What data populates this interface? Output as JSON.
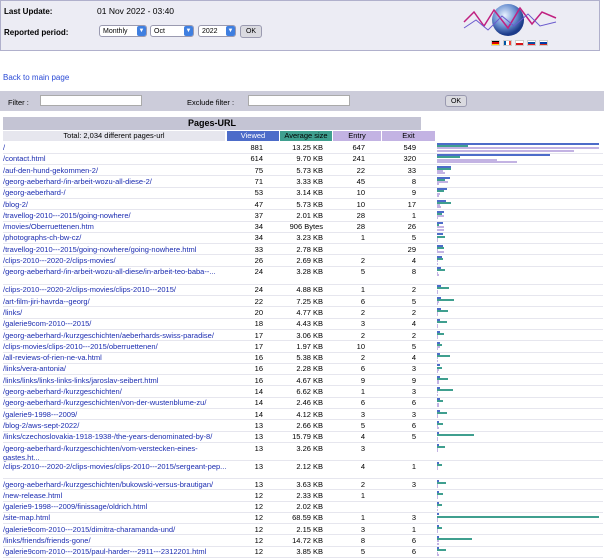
{
  "header": {
    "last_update_label": "Last Update:",
    "last_update_value": "01 Nov 2022 - 03:40",
    "reported_label": "Reported period:",
    "period_type": "Monthly",
    "month": "Oct",
    "year": "2022",
    "ok_label": "OK"
  },
  "back_link": "Back to main page",
  "filter": {
    "filter_label": "Filter :",
    "exclude_label": "Exclude filter :",
    "ok_label": "OK"
  },
  "table": {
    "title": "Pages-URL",
    "total_label": "Total: 2,034 different pages-url",
    "columns": [
      "Viewed",
      "Average size",
      "Entry",
      "Exit"
    ],
    "colors": {
      "viewed": "#4d6cc9",
      "avgsize": "#3f9f8f",
      "entry": "#c3b3e3",
      "exit": "#c3b3e3"
    },
    "rows": [
      {
        "url": "/",
        "viewed": 881,
        "size": "13.25 KB",
        "entry": "647",
        "exit": "549"
      },
      {
        "url": "/contact.html",
        "viewed": 614,
        "size": "9.70 KB",
        "entry": "241",
        "exit": "320"
      },
      {
        "url": "/auf-den-hund-gekommen-2/",
        "viewed": 75,
        "size": "5.73 KB",
        "entry": "22",
        "exit": "33"
      },
      {
        "url": "/georg-aeberhard-/in-arbeit-wozu-all-diese-2/",
        "viewed": 71,
        "size": "3.33 KB",
        "entry": "45",
        "exit": "8"
      },
      {
        "url": "/georg-aeberhard-/",
        "viewed": 53,
        "size": "3.14 KB",
        "entry": "10",
        "exit": "9"
      },
      {
        "url": "/blog-2/",
        "viewed": 47,
        "size": "5.73 KB",
        "entry": "10",
        "exit": "17"
      },
      {
        "url": "/travellog-2010---2015/going-nowhere/",
        "viewed": 37,
        "size": "2.01 KB",
        "entry": "28",
        "exit": "1"
      },
      {
        "url": "/movies/Oberruettenen.htm",
        "viewed": 34,
        "size": "906 Bytes",
        "entry": "28",
        "exit": "26"
      },
      {
        "url": "/photographs-ch-bw-cz/",
        "viewed": 34,
        "size": "3.23 KB",
        "entry": "1",
        "exit": "5"
      },
      {
        "url": "/travellog-2010---2015/going-nowhere/going-nowhere.html",
        "viewed": 33,
        "size": "2.78 KB",
        "entry": "",
        "exit": "29"
      },
      {
        "url": "/clips-2010---2020-2/clips-movies/",
        "viewed": 26,
        "size": "2.69 KB",
        "entry": "2",
        "exit": "4"
      },
      {
        "url": "/georg-aeberhard-/in-arbeit-wozu-all-diese/in-arbeit-teo-baba--...",
        "viewed": 24,
        "size": "3.28 KB",
        "entry": "5",
        "exit": "8"
      },
      {
        "url": "/clips-2010---2020-2/clips-movies/clips-2010---2015/",
        "viewed": 24,
        "size": "4.88 KB",
        "entry": "1",
        "exit": "2"
      },
      {
        "url": "/art-film-jiri-havrda--georg/",
        "viewed": 22,
        "size": "7.25 KB",
        "entry": "6",
        "exit": "5"
      },
      {
        "url": "/links/",
        "viewed": 20,
        "size": "4.77 KB",
        "entry": "2",
        "exit": "2"
      },
      {
        "url": "/galerie9com-2010---2015/",
        "viewed": 18,
        "size": "4.43 KB",
        "entry": "3",
        "exit": "4"
      },
      {
        "url": "/georg-aeberhard-/kurzgeschichten/aeberhards-swiss-paradise/",
        "viewed": 17,
        "size": "3.06 KB",
        "entry": "2",
        "exit": "2"
      },
      {
        "url": "/clips-movies/clips-2010---2015/oberruettenen/",
        "viewed": 17,
        "size": "1.97 KB",
        "entry": "10",
        "exit": "5"
      },
      {
        "url": "/all-reviews-of-rien-ne-va.html",
        "viewed": 16,
        "size": "5.38 KB",
        "entry": "2",
        "exit": "4"
      },
      {
        "url": "/links/vera-antonia/",
        "viewed": 16,
        "size": "2.28 KB",
        "entry": "6",
        "exit": "3"
      },
      {
        "url": "/links/links/links-links-links/jaroslav-seibert.html",
        "viewed": 16,
        "size": "4.67 KB",
        "entry": "9",
        "exit": "9"
      },
      {
        "url": "/georg-aeberhard-/kurzgeschichten/",
        "viewed": 14,
        "size": "6.62 KB",
        "entry": "1",
        "exit": "3"
      },
      {
        "url": "/georg-aeberhard-/kurzgeschichten/von-der-wustenblume-zu/",
        "viewed": 14,
        "size": "2.46 KB",
        "entry": "6",
        "exit": "6"
      },
      {
        "url": "/galerie9-1998---2009/",
        "viewed": 14,
        "size": "4.12 KB",
        "entry": "3",
        "exit": "3"
      },
      {
        "url": "/blog-2/aws-sept-2022/",
        "viewed": 13,
        "size": "2.66 KB",
        "entry": "5",
        "exit": "6"
      },
      {
        "url": "/links/czechoslovakia-1918-1938-/the-years-denominated-by-8/",
        "viewed": 13,
        "size": "15.79 KB",
        "entry": "4",
        "exit": "5"
      },
      {
        "url": "/georg-aeberhard-/kurzgeschichten/vom-verstecken-eines-gastes.ht...",
        "viewed": 13,
        "size": "3.26 KB",
        "entry": "3",
        "exit": ""
      },
      {
        "url": "/clips-2010---2020-2/clips-movies/clips-2010---2015/sergeant-pep...",
        "viewed": 13,
        "size": "2.12 KB",
        "entry": "4",
        "exit": "1"
      },
      {
        "url": "/georg-aeberhard-/kurzgeschichten/bukowski-versus-brautigan/",
        "viewed": 13,
        "size": "3.63 KB",
        "entry": "2",
        "exit": "3"
      },
      {
        "url": "/new-release.html",
        "viewed": 12,
        "size": "2.33 KB",
        "entry": "1",
        "exit": ""
      },
      {
        "url": "/galerie9-1998---2009/finissage/oldrich.html",
        "viewed": 12,
        "size": "2.02 KB",
        "entry": "",
        "exit": ""
      },
      {
        "url": "/site-map.html",
        "viewed": 12,
        "size": "68.59 KB",
        "entry": "1",
        "exit": "3"
      },
      {
        "url": "/galerie9com-2010---2015/dimitra-charamanda-und/",
        "viewed": 12,
        "size": "2.15 KB",
        "entry": "3",
        "exit": "1"
      },
      {
        "url": "/links/friends/friends-gone/",
        "viewed": 12,
        "size": "14.72 KB",
        "entry": "8",
        "exit": "6"
      },
      {
        "url": "/galerie9com-2010---2015/paul-harder---2911---2312201.html",
        "viewed": 12,
        "size": "3.85 KB",
        "entry": "5",
        "exit": "6"
      }
    ]
  }
}
